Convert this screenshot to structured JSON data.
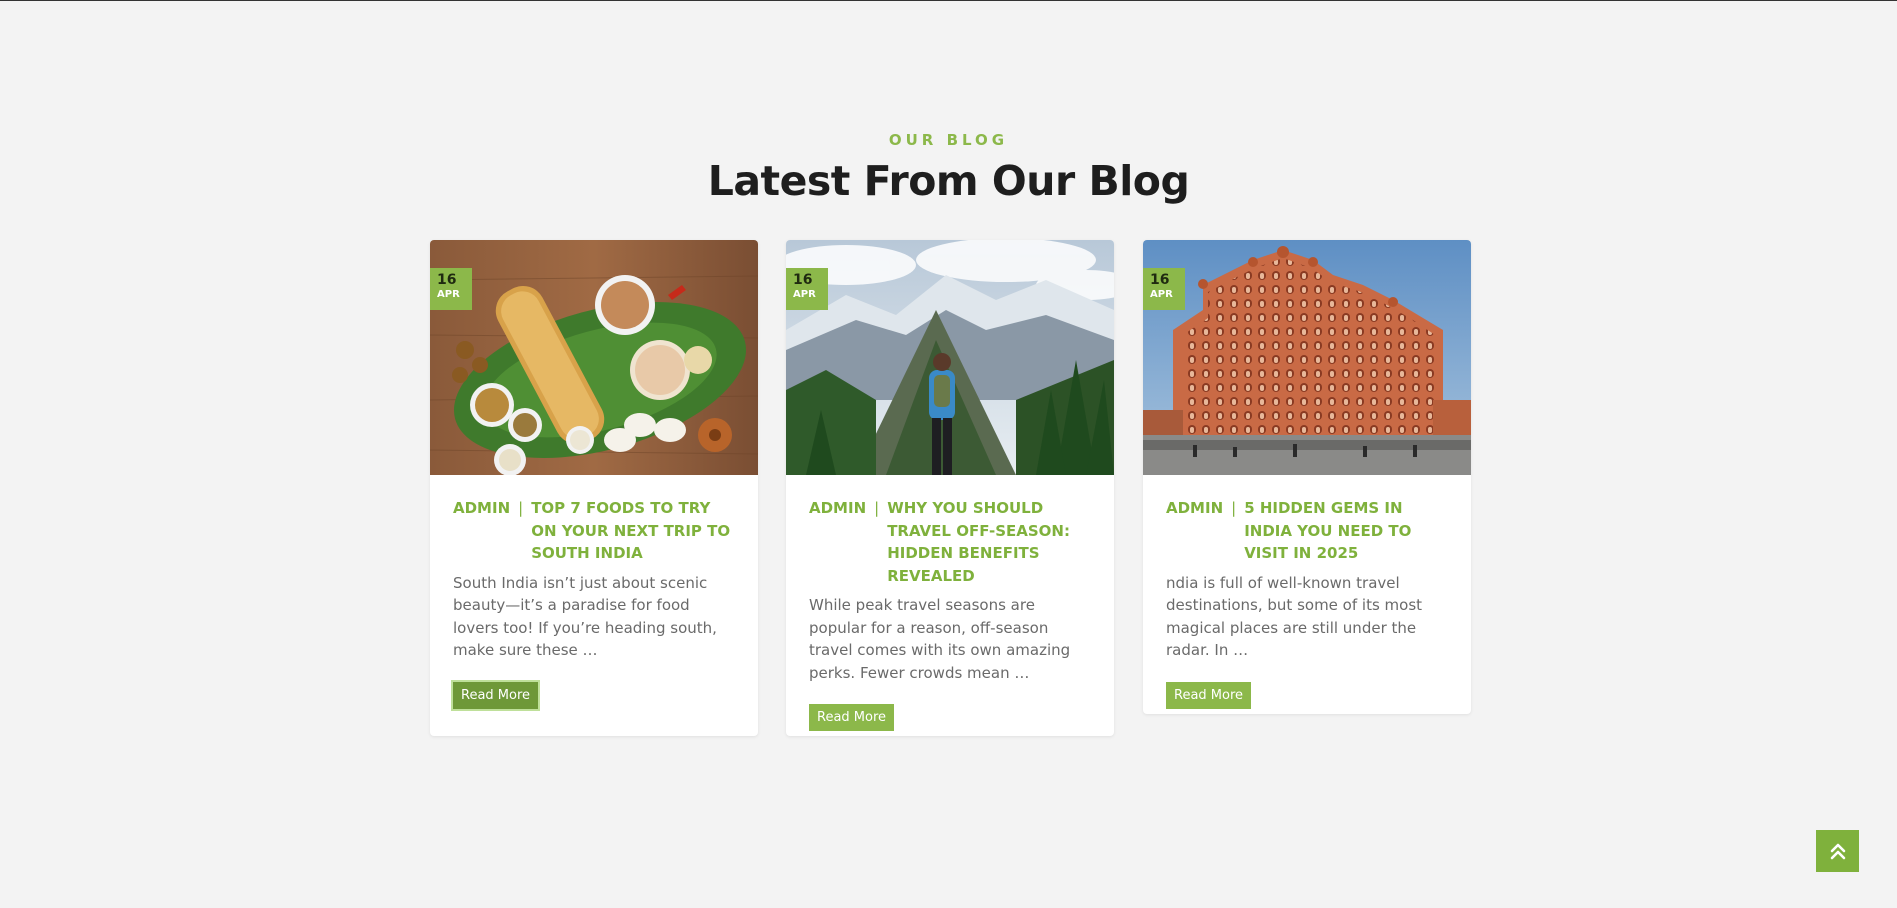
{
  "section": {
    "eyebrow": "OUR BLOG",
    "title": "Latest From Our Blog"
  },
  "accent_color": "#8cb84a",
  "posts": [
    {
      "day": "16",
      "month": "APR",
      "author": "ADMIN",
      "separator": "|",
      "title": "TOP 7 FOODS TO TRY ON YOUR NEXT TRIP TO SOUTH INDIA",
      "excerpt": "South India isn’t just about scenic beauty—it’s a paradise for food lovers too! If you’re heading south, make sure these …",
      "button": "Read More",
      "image": "south-indian-food-photo"
    },
    {
      "day": "16",
      "month": "APR",
      "author": "ADMIN",
      "separator": "|",
      "title": "WHY YOU SHOULD TRAVEL OFF-SEASON: HIDDEN BENEFITS REVEALED",
      "excerpt": "While peak travel seasons are popular for a reason, off-season travel comes with its own amazing perks. Fewer crowds mean …",
      "button": "Read More",
      "image": "mountain-hiker-photo"
    },
    {
      "day": "16",
      "month": "APR",
      "author": "ADMIN",
      "separator": "|",
      "title": "5 HIDDEN GEMS IN INDIA YOU NEED TO VISIT IN 2025",
      "excerpt": "ndia is full of well-known travel destinations, but some of its most magical places are still under the radar. In …",
      "button": "Read More",
      "image": "hawa-mahal-palace-photo"
    }
  ],
  "back_to_top": {
    "icon": "double-chevron-up-icon"
  }
}
